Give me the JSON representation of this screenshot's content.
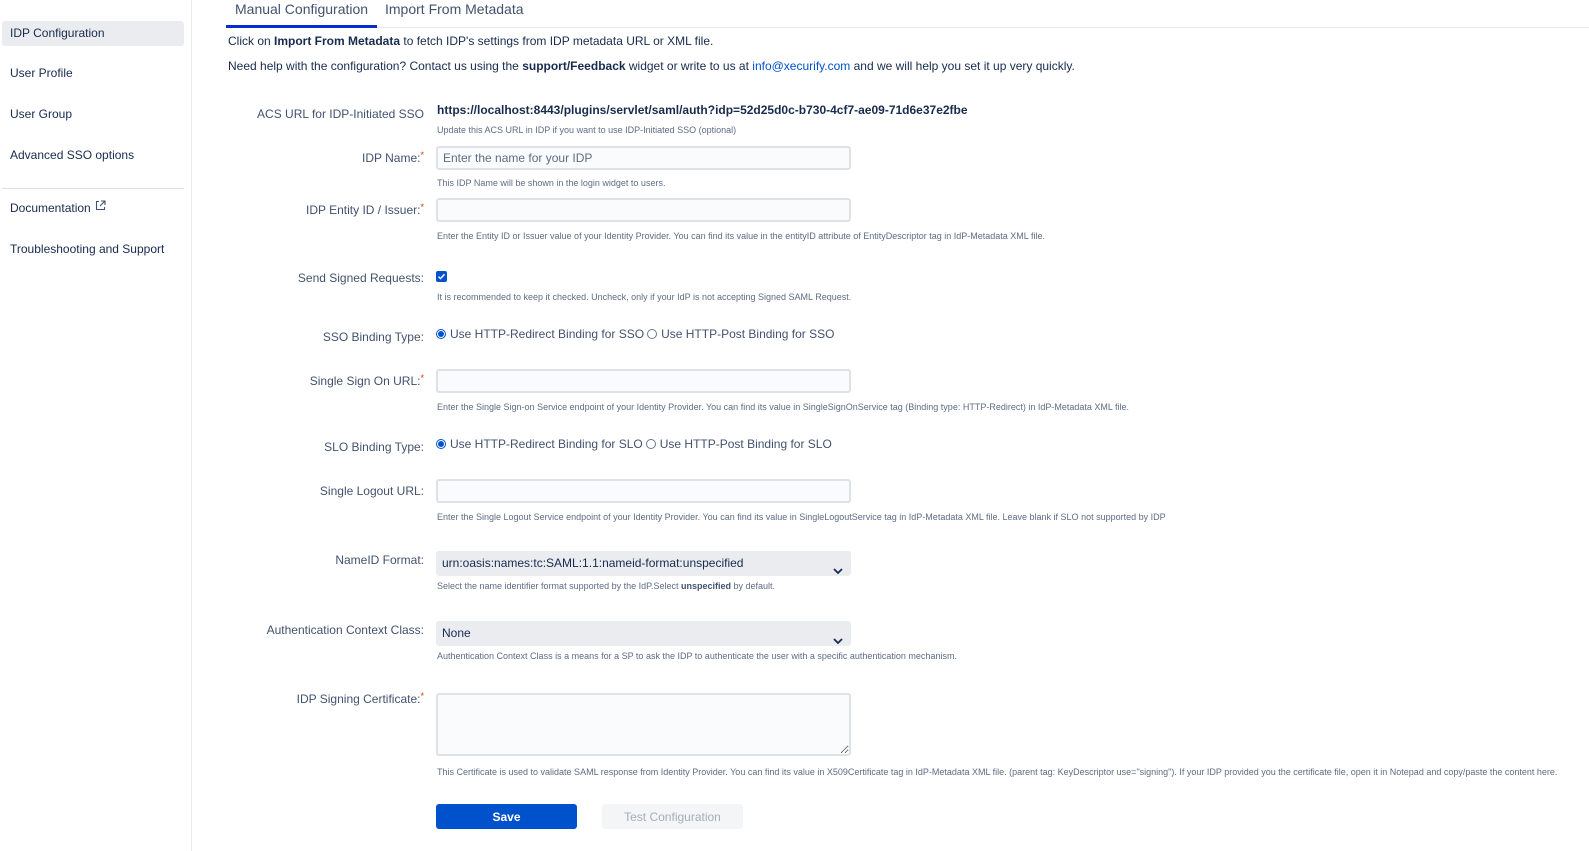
{
  "sidebar": {
    "items": [
      {
        "label": "IDP Configuration",
        "active": true
      },
      {
        "label": "User Profile"
      },
      {
        "label": "User Group"
      },
      {
        "label": "Advanced SSO options"
      },
      {
        "label": "Documentation",
        "icon": "external-link-icon"
      },
      {
        "label": "Troubleshooting and Support"
      }
    ]
  },
  "tabs": [
    {
      "label": "Manual Configuration",
      "active": true
    },
    {
      "label": "Import From Metadata"
    }
  ],
  "intro": {
    "line1_pre": "Click on ",
    "line1_bold": "Import From Metadata",
    "line1_post": " to fetch IDP's settings from IDP metadata URL or XML file.",
    "line2_pre": "Need help with the configuration? Contact us using the ",
    "line2_bold": "support/Feedback",
    "line2_mid": " widget or write to us at ",
    "line2_link": "info@xecurify.com",
    "line2_post": " and we will help you set it up very quickly."
  },
  "form": {
    "acs": {
      "label": "ACS URL for IDP-Initiated SSO",
      "value": "https://localhost:8443/plugins/servlet/saml/auth?idp=52d25d0c-b730-4cf7-ae09-71d6e37e2fbe",
      "help": "Update this ACS URL in IDP if you want to use IDP-Initiated SSO (optional)"
    },
    "idp_name": {
      "label": "IDP Name:",
      "required": "*",
      "placeholder": "Enter the name for your IDP",
      "value": "",
      "help": "This IDP Name will be shown in the login widget to users."
    },
    "entity_id": {
      "label": "IDP Entity ID / Issuer:",
      "required": "*",
      "value": "",
      "help": "Enter the Entity ID or Issuer value of your Identity Provider. You can find its value in the entityID attribute of EntityDescriptor tag in IdP-Metadata XML file."
    },
    "signed_requests": {
      "label": "Send Signed Requests:",
      "checked": true,
      "help": "It is recommended to keep it checked. Uncheck, only if your IdP is not accepting Signed SAML Request."
    },
    "sso_binding": {
      "label": "SSO Binding Type:",
      "options": [
        {
          "label": "Use HTTP-Redirect Binding for SSO",
          "checked": true
        },
        {
          "label": "Use HTTP-Post Binding for SSO",
          "checked": false
        }
      ]
    },
    "sso_url": {
      "label": "Single Sign On URL:",
      "required": "*",
      "value": "",
      "help": "Enter the Single Sign-on Service endpoint of your Identity Provider. You can find its value in SingleSignOnService tag (Binding type: HTTP-Redirect) in IdP-Metadata XML file."
    },
    "slo_binding": {
      "label": "SLO Binding Type:",
      "options": [
        {
          "label": "Use HTTP-Redirect Binding for SLO",
          "checked": true
        },
        {
          "label": "Use HTTP-Post Binding for SLO",
          "checked": false
        }
      ]
    },
    "slo_url": {
      "label": "Single Logout URL:",
      "value": "",
      "help": "Enter the Single Logout Service endpoint of your Identity Provider. You can find its value in SingleLogoutService tag in IdP-Metadata XML file. Leave blank if SLO not supported by IDP"
    },
    "nameid": {
      "label": "NameID Format:",
      "selected": "urn:oasis:names:tc:SAML:1.1:nameid-format:unspecified",
      "help_pre": "Select the name identifier format supported by the IdP.Select ",
      "help_bold": "unspecified",
      "help_post": " by default."
    },
    "auth_context": {
      "label": "Authentication Context Class:",
      "selected": "None",
      "help": "Authentication Context Class is a means for a SP to ask the IDP to authenticate the user with a specific authentication mechanism."
    },
    "certificate": {
      "label": "IDP Signing Certificate:",
      "required": "*",
      "value": "",
      "help": "This Certificate is used to validate SAML response from Identity Provider. You can find its value in X509Certificate tag in IdP-Metadata XML file. (parent tag: KeyDescriptor use=\"signing\"). If your IDP provided you the certificate file, open it in Notepad and copy/paste the content here."
    }
  },
  "buttons": {
    "save": "Save",
    "test": "Test Configuration"
  },
  "colors": {
    "primary": "#0052cc",
    "tab_indicator": "#0a2bd1",
    "required": "#de350b"
  }
}
